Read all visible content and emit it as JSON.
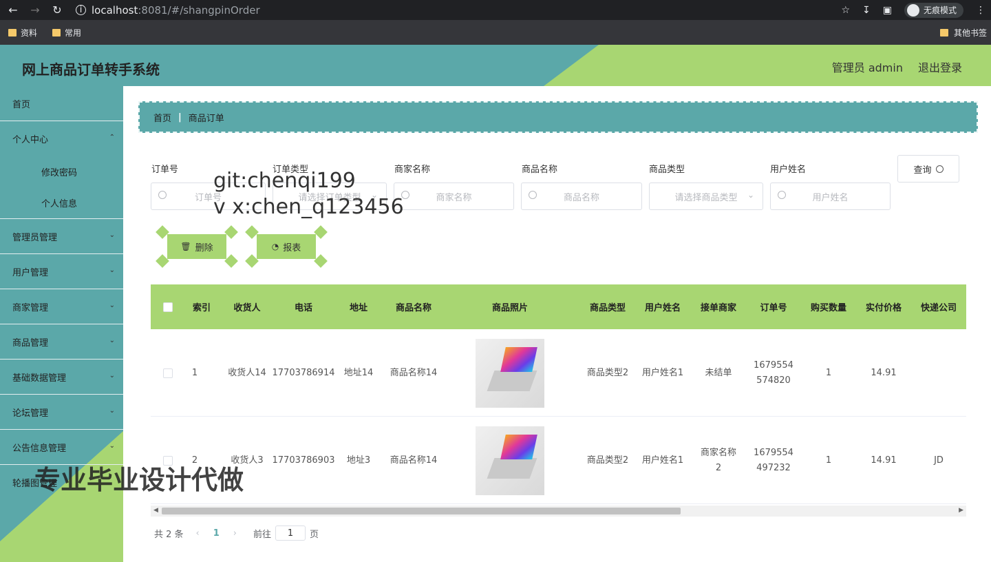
{
  "browser": {
    "url_host": "localhost",
    "url_rest": ":8081/#/shangpinOrder",
    "incognito_label": "无痕模式",
    "bookmarks": [
      "资料",
      "常用"
    ],
    "other_bookmarks": "其他书签"
  },
  "header": {
    "title": "网上商品订单转手系统",
    "user_label": "管理员 admin",
    "logout_label": "退出登录"
  },
  "sidebar": {
    "items": [
      {
        "label": "首页"
      },
      {
        "label": "个人中心"
      },
      {
        "label": "管理员管理"
      },
      {
        "label": "用户管理"
      },
      {
        "label": "商家管理"
      },
      {
        "label": "商品管理"
      },
      {
        "label": "基础数据管理"
      },
      {
        "label": "论坛管理"
      },
      {
        "label": "公告信息管理"
      },
      {
        "label": "轮播图管理"
      }
    ],
    "sub_items": [
      "修改密码",
      "个人信息"
    ]
  },
  "breadcrumb": {
    "home": "首页",
    "current": "商品订单"
  },
  "filters": {
    "order_no": {
      "label": "订单号",
      "placeholder": "订单号"
    },
    "order_type": {
      "label": "订单类型",
      "placeholder": "请选择订单类型"
    },
    "merchant_name": {
      "label": "商家名称",
      "placeholder": "商家名称"
    },
    "product_name": {
      "label": "商品名称",
      "placeholder": "商品名称"
    },
    "product_type": {
      "label": "商品类型",
      "placeholder": "请选择商品类型"
    },
    "user_name": {
      "label": "用户姓名",
      "placeholder": "用户姓名"
    },
    "query_label": "查询"
  },
  "actions": {
    "delete_label": "删除",
    "report_label": "报表"
  },
  "table": {
    "headers": [
      "索引",
      "收货人",
      "电话",
      "地址",
      "商品名称",
      "商品照片",
      "商品类型",
      "用户姓名",
      "接单商家",
      "订单号",
      "购买数量",
      "实付价格",
      "快递公司"
    ],
    "rows": [
      {
        "index": "1",
        "receiver": "收货人14",
        "phone": "17703786914",
        "address": "地址14",
        "product": "商品名称14",
        "type": "商品类型2",
        "user": "用户姓名1",
        "merchant": "未结单",
        "order": "1679554574820",
        "qty": "1",
        "price": "14.91",
        "express": ""
      },
      {
        "index": "2",
        "receiver": "收货人3",
        "phone": "17703786903",
        "address": "地址3",
        "product": "商品名称14",
        "type": "商品类型2",
        "user": "用户姓名1",
        "merchant": "商家名称2",
        "order": "1679554497232",
        "qty": "1",
        "price": "14.91",
        "express": "JD"
      }
    ]
  },
  "pager": {
    "total": "共 2 条",
    "page": "1",
    "goto": "前往",
    "goto_value": "1",
    "page_unit": "页"
  },
  "watermarks": {
    "line1": "git:chenqi199",
    "line2": "v x:chen_q123456",
    "bottom": "专业毕业设计代做"
  }
}
